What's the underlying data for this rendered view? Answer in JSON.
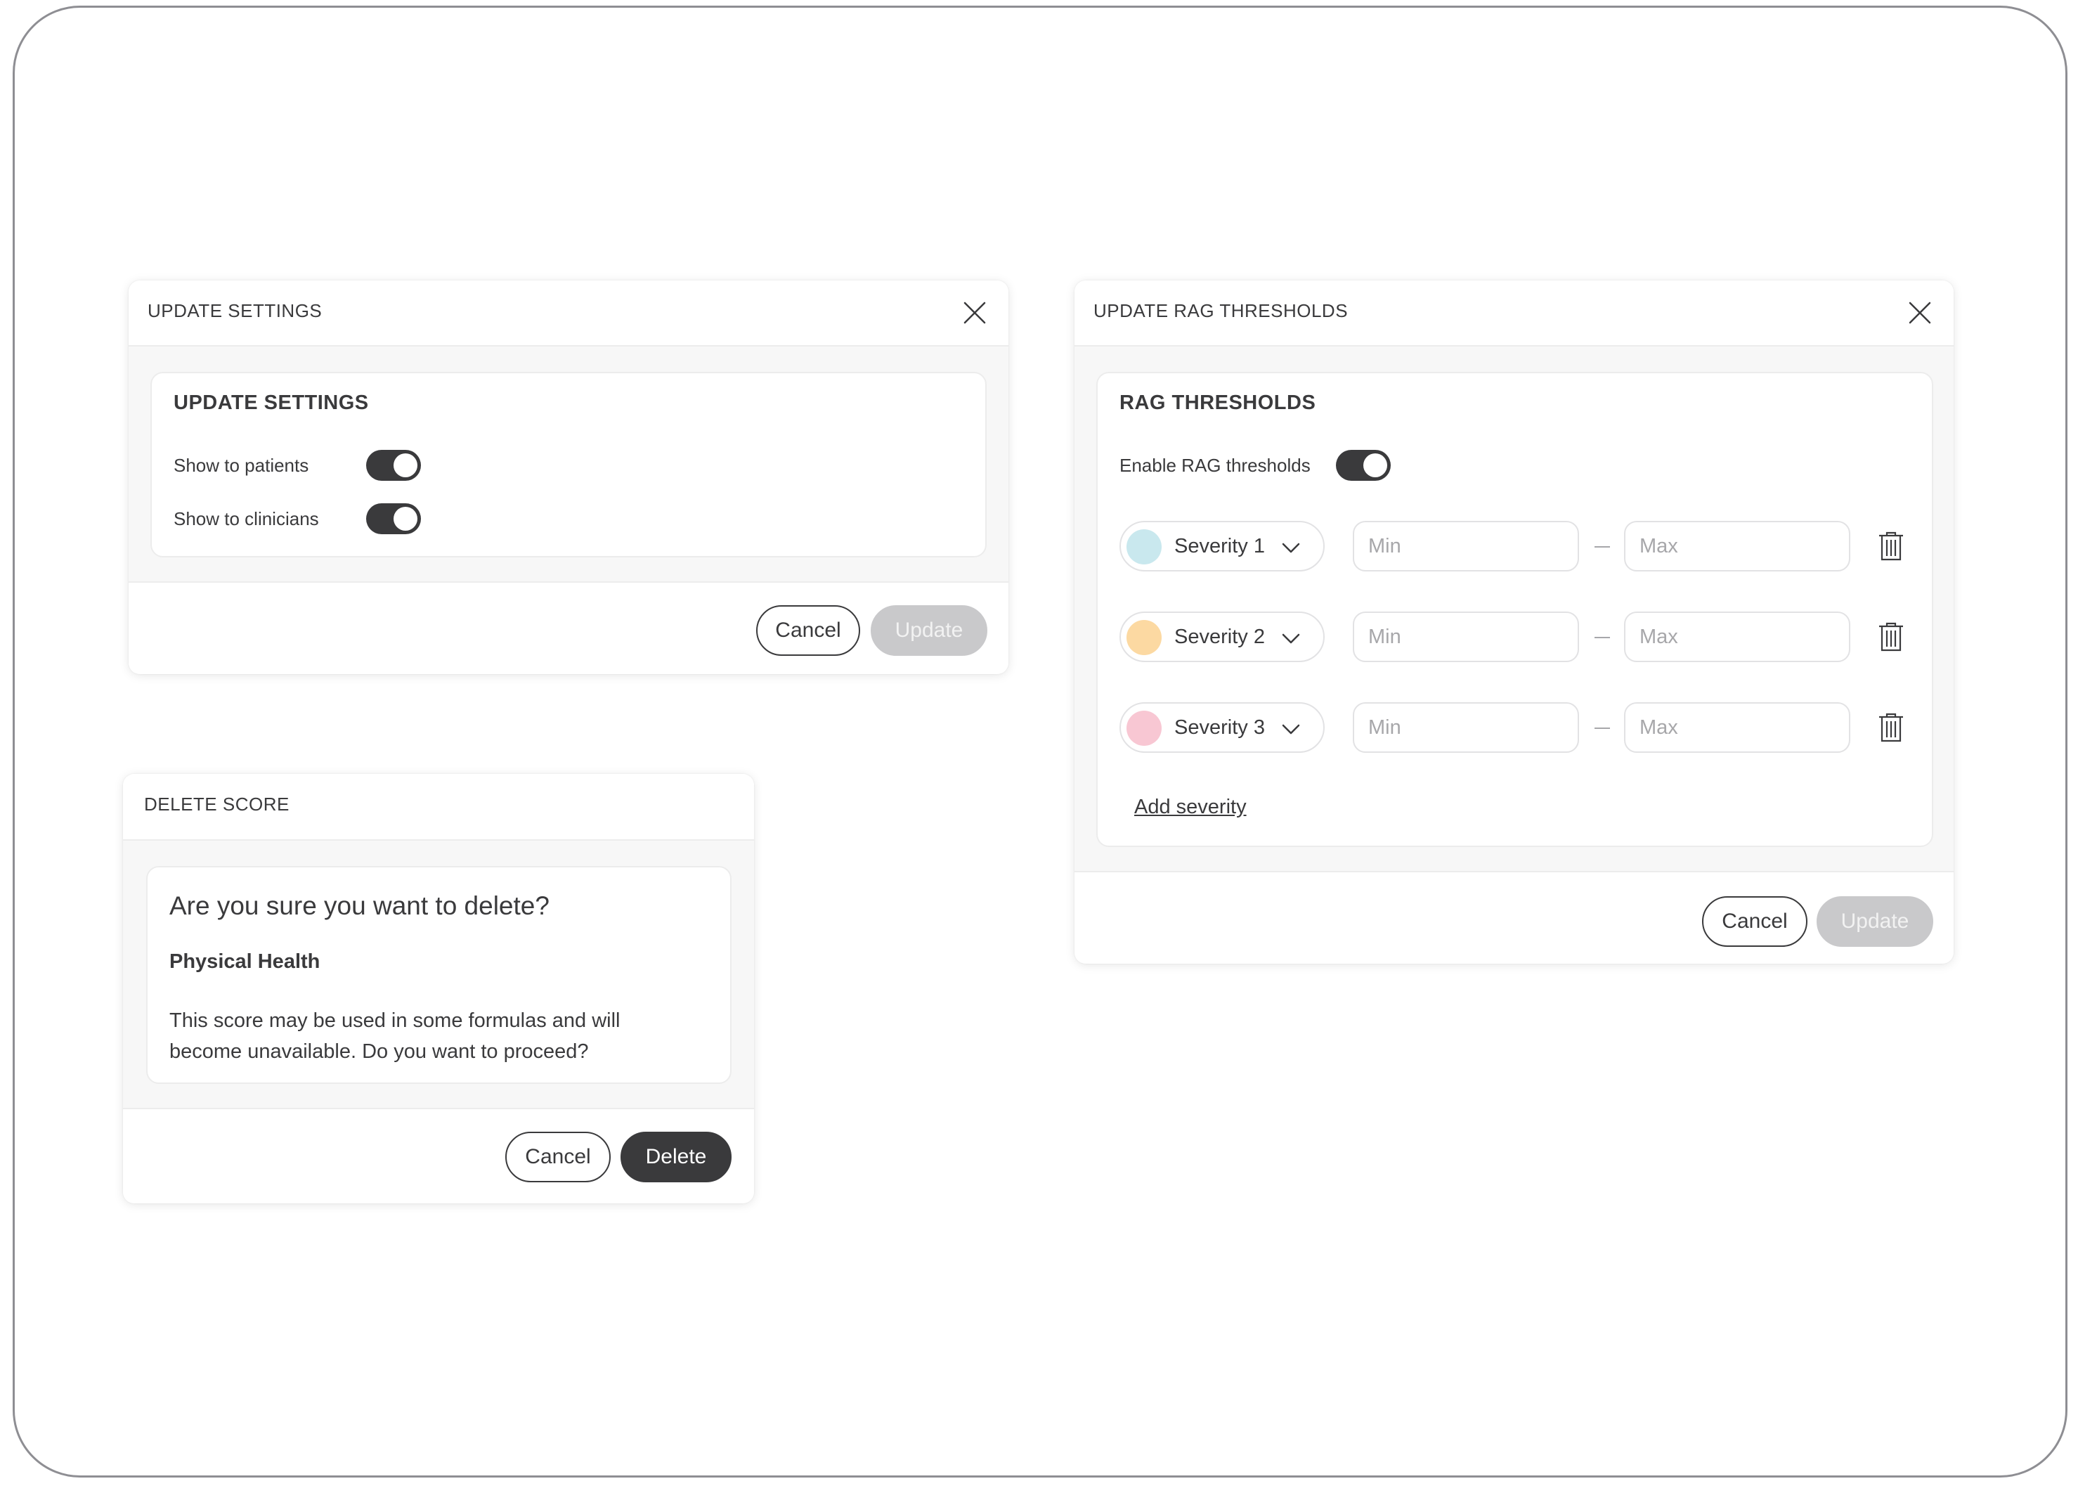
{
  "update_settings_modal": {
    "header_title": "UPDATE SETTINGS",
    "card_title": "UPDATE SETTINGS",
    "rows": [
      {
        "label": "Show to patients",
        "enabled": true
      },
      {
        "label": "Show to clinicians",
        "enabled": true
      }
    ],
    "cancel_label": "Cancel",
    "update_label": "Update"
  },
  "rag_modal": {
    "header_title": "UPDATE RAG THRESHOLDS",
    "card_title": "RAG THRESHOLDS",
    "enable_label": "Enable RAG thresholds",
    "enabled": true,
    "severities": [
      {
        "label": "Severity 1",
        "color": "#c9e8ee",
        "min_placeholder": "Min",
        "max_placeholder": "Max"
      },
      {
        "label": "Severity 2",
        "color": "#fcd9a2",
        "min_placeholder": "Min",
        "max_placeholder": "Max"
      },
      {
        "label": "Severity 3",
        "color": "#f8c7d3",
        "min_placeholder": "Min",
        "max_placeholder": "Max"
      }
    ],
    "add_severity_label": "Add severity",
    "cancel_label": "Cancel",
    "update_label": "Update"
  },
  "delete_modal": {
    "header_title": "DELETE SCORE",
    "question": "Are you sure you want to delete?",
    "item_name": "Physical Health",
    "message": "This score may be used in some formulas and will become unavailable. Do you want to proceed?",
    "cancel_label": "Cancel",
    "delete_label": "Delete"
  },
  "icons": {
    "close": "close-icon",
    "chevron": "chevron-down-icon",
    "trash": "trash-icon"
  },
  "colors": {
    "dark": "#3a3a3c",
    "disabled": "#c9c9cb",
    "panel_bg": "#f7f7f7"
  }
}
